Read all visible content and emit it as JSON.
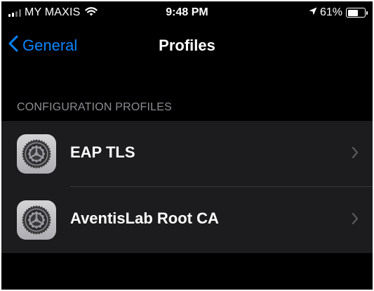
{
  "status_bar": {
    "carrier": "MY MAXIS",
    "time": "9:48 PM",
    "battery_percent": "61%",
    "battery_level": 0.61,
    "signal_bars": 2,
    "icons": [
      "signal-bars-icon",
      "wifi-icon",
      "location-arrow-icon",
      "battery-icon"
    ]
  },
  "nav": {
    "back_label": "General",
    "title": "Profiles"
  },
  "section": {
    "header": "CONFIGURATION PROFILES"
  },
  "profiles": [
    {
      "label": "EAP TLS",
      "icon": "settings-gear-icon"
    },
    {
      "label": "AventisLab Root CA",
      "icon": "settings-gear-icon"
    }
  ],
  "colors": {
    "accent": "#0a84ff",
    "background": "#000000",
    "cell_background": "#1c1c1e",
    "section_header": "#8d8d93"
  }
}
